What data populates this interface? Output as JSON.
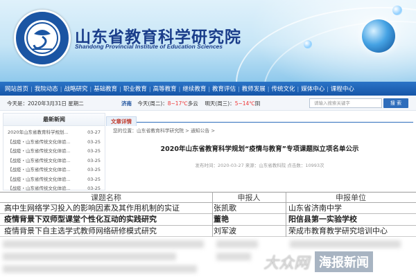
{
  "header": {
    "title": "山东省教育科学研究院",
    "subtitle": "Shandong Provincial Institute of Education Sciences"
  },
  "nav": {
    "items": [
      "网站首页",
      "我院动态",
      "战略研究",
      "基础教育",
      "职业教育",
      "高等教育",
      "继续教育",
      "教育评估",
      "教师发展",
      "传统文化",
      "媒体中心",
      "课程中心"
    ]
  },
  "infobar": {
    "date": "今天是：2020年3月31日  星期二",
    "city": "济南",
    "today_label": "今天(周二)：",
    "today_temp": "8~17℃",
    "today_desc": "多云",
    "tomorrow_label": "明天(周三)：",
    "tomorrow_temp": "5~14℃",
    "tomorrow_desc": "阴",
    "search_placeholder": "请输入搜索关键字",
    "search_button": "搜 索"
  },
  "sidebar": {
    "title": "最新新闻",
    "items": [
      {
        "title": "2020年山东省教育科学规划...",
        "date": "03-27"
      },
      {
        "title": "【战疫・山东省传统文化体验...",
        "date": "03-25"
      },
      {
        "title": "【战疫・山东省传统文化体验...",
        "date": "03-25"
      },
      {
        "title": "【战疫・山东省传统文化体验...",
        "date": "03-25"
      },
      {
        "title": "【战疫・山东省传统文化体验...",
        "date": "03-25"
      },
      {
        "title": "【战疫・山东省传统文化体验...",
        "date": "03-25"
      },
      {
        "title": "【战疫・山东省传统文化体验...",
        "date": "03-25"
      }
    ]
  },
  "main": {
    "tab": "文章详情",
    "breadcrumb": "您的位置：山东省教育科学研究院 > 通知公告 >",
    "article_title": "2020年山东省教育科学规划“疫情与教育”专项课题拟立项名单公示",
    "article_meta": "发布时间：2020-03-27  来源：山东省教科院  点击数：10993次"
  },
  "table": {
    "headers": [
      "课题名称",
      "申报人",
      "申报单位"
    ],
    "rows": [
      {
        "title": "高中生网络学习投入的影响因素及其作用机制的实证",
        "person": "张凯歌",
        "unit": "山东省济南中学",
        "bold": false
      },
      {
        "title": "疫情背景下双师型课堂个性化互动的实践研究",
        "person": "董艳",
        "unit": "阳信县第一实验学校",
        "bold": true
      },
      {
        "title": "疫情背景下自主选学式教师网络研修模式研究",
        "person": "刘军波",
        "unit": "荣成市教育教学研究培训中心",
        "bold": false
      }
    ]
  },
  "watermark": {
    "left": "大众网",
    "right": "海报新闻"
  }
}
